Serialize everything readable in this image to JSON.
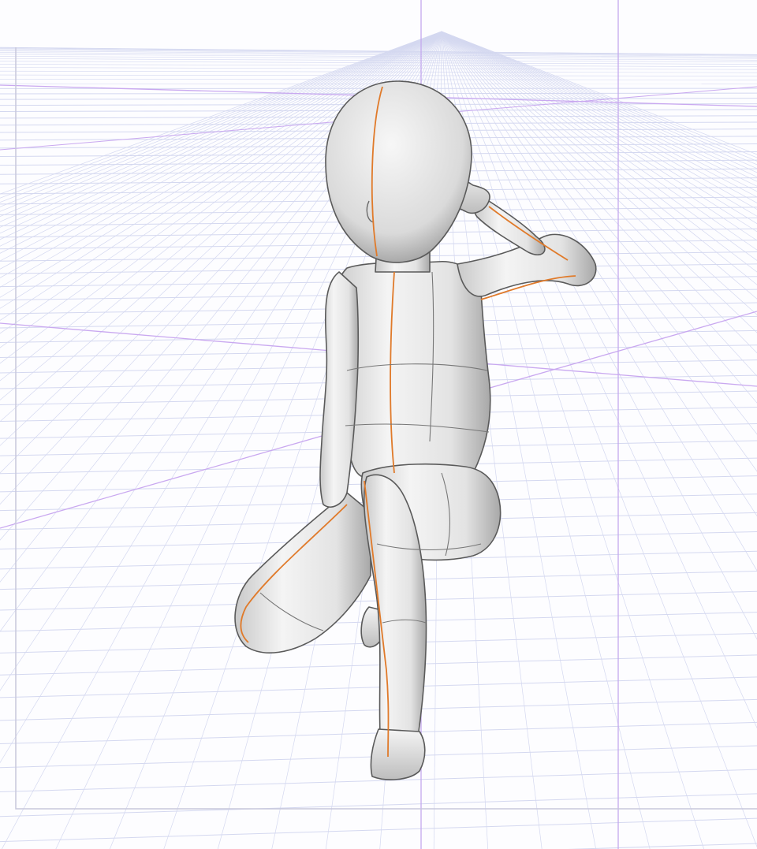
{
  "viewport": {
    "background": "#fdfdff",
    "grid_color": "#d4d8f0",
    "guide_color": "#b89be6",
    "axis_color": "#c9a8f0",
    "frame_color": "#c8c8dc"
  },
  "figure": {
    "skin_light": "#f2f2f2",
    "skin_mid": "#d6d6d6",
    "skin_dark": "#8a8a8a",
    "outline": "#555555",
    "seam_color": "#6e6e6e",
    "center_line_color": "#e07a2a"
  },
  "icons": {
    "figure": "posable-3d-figure"
  }
}
